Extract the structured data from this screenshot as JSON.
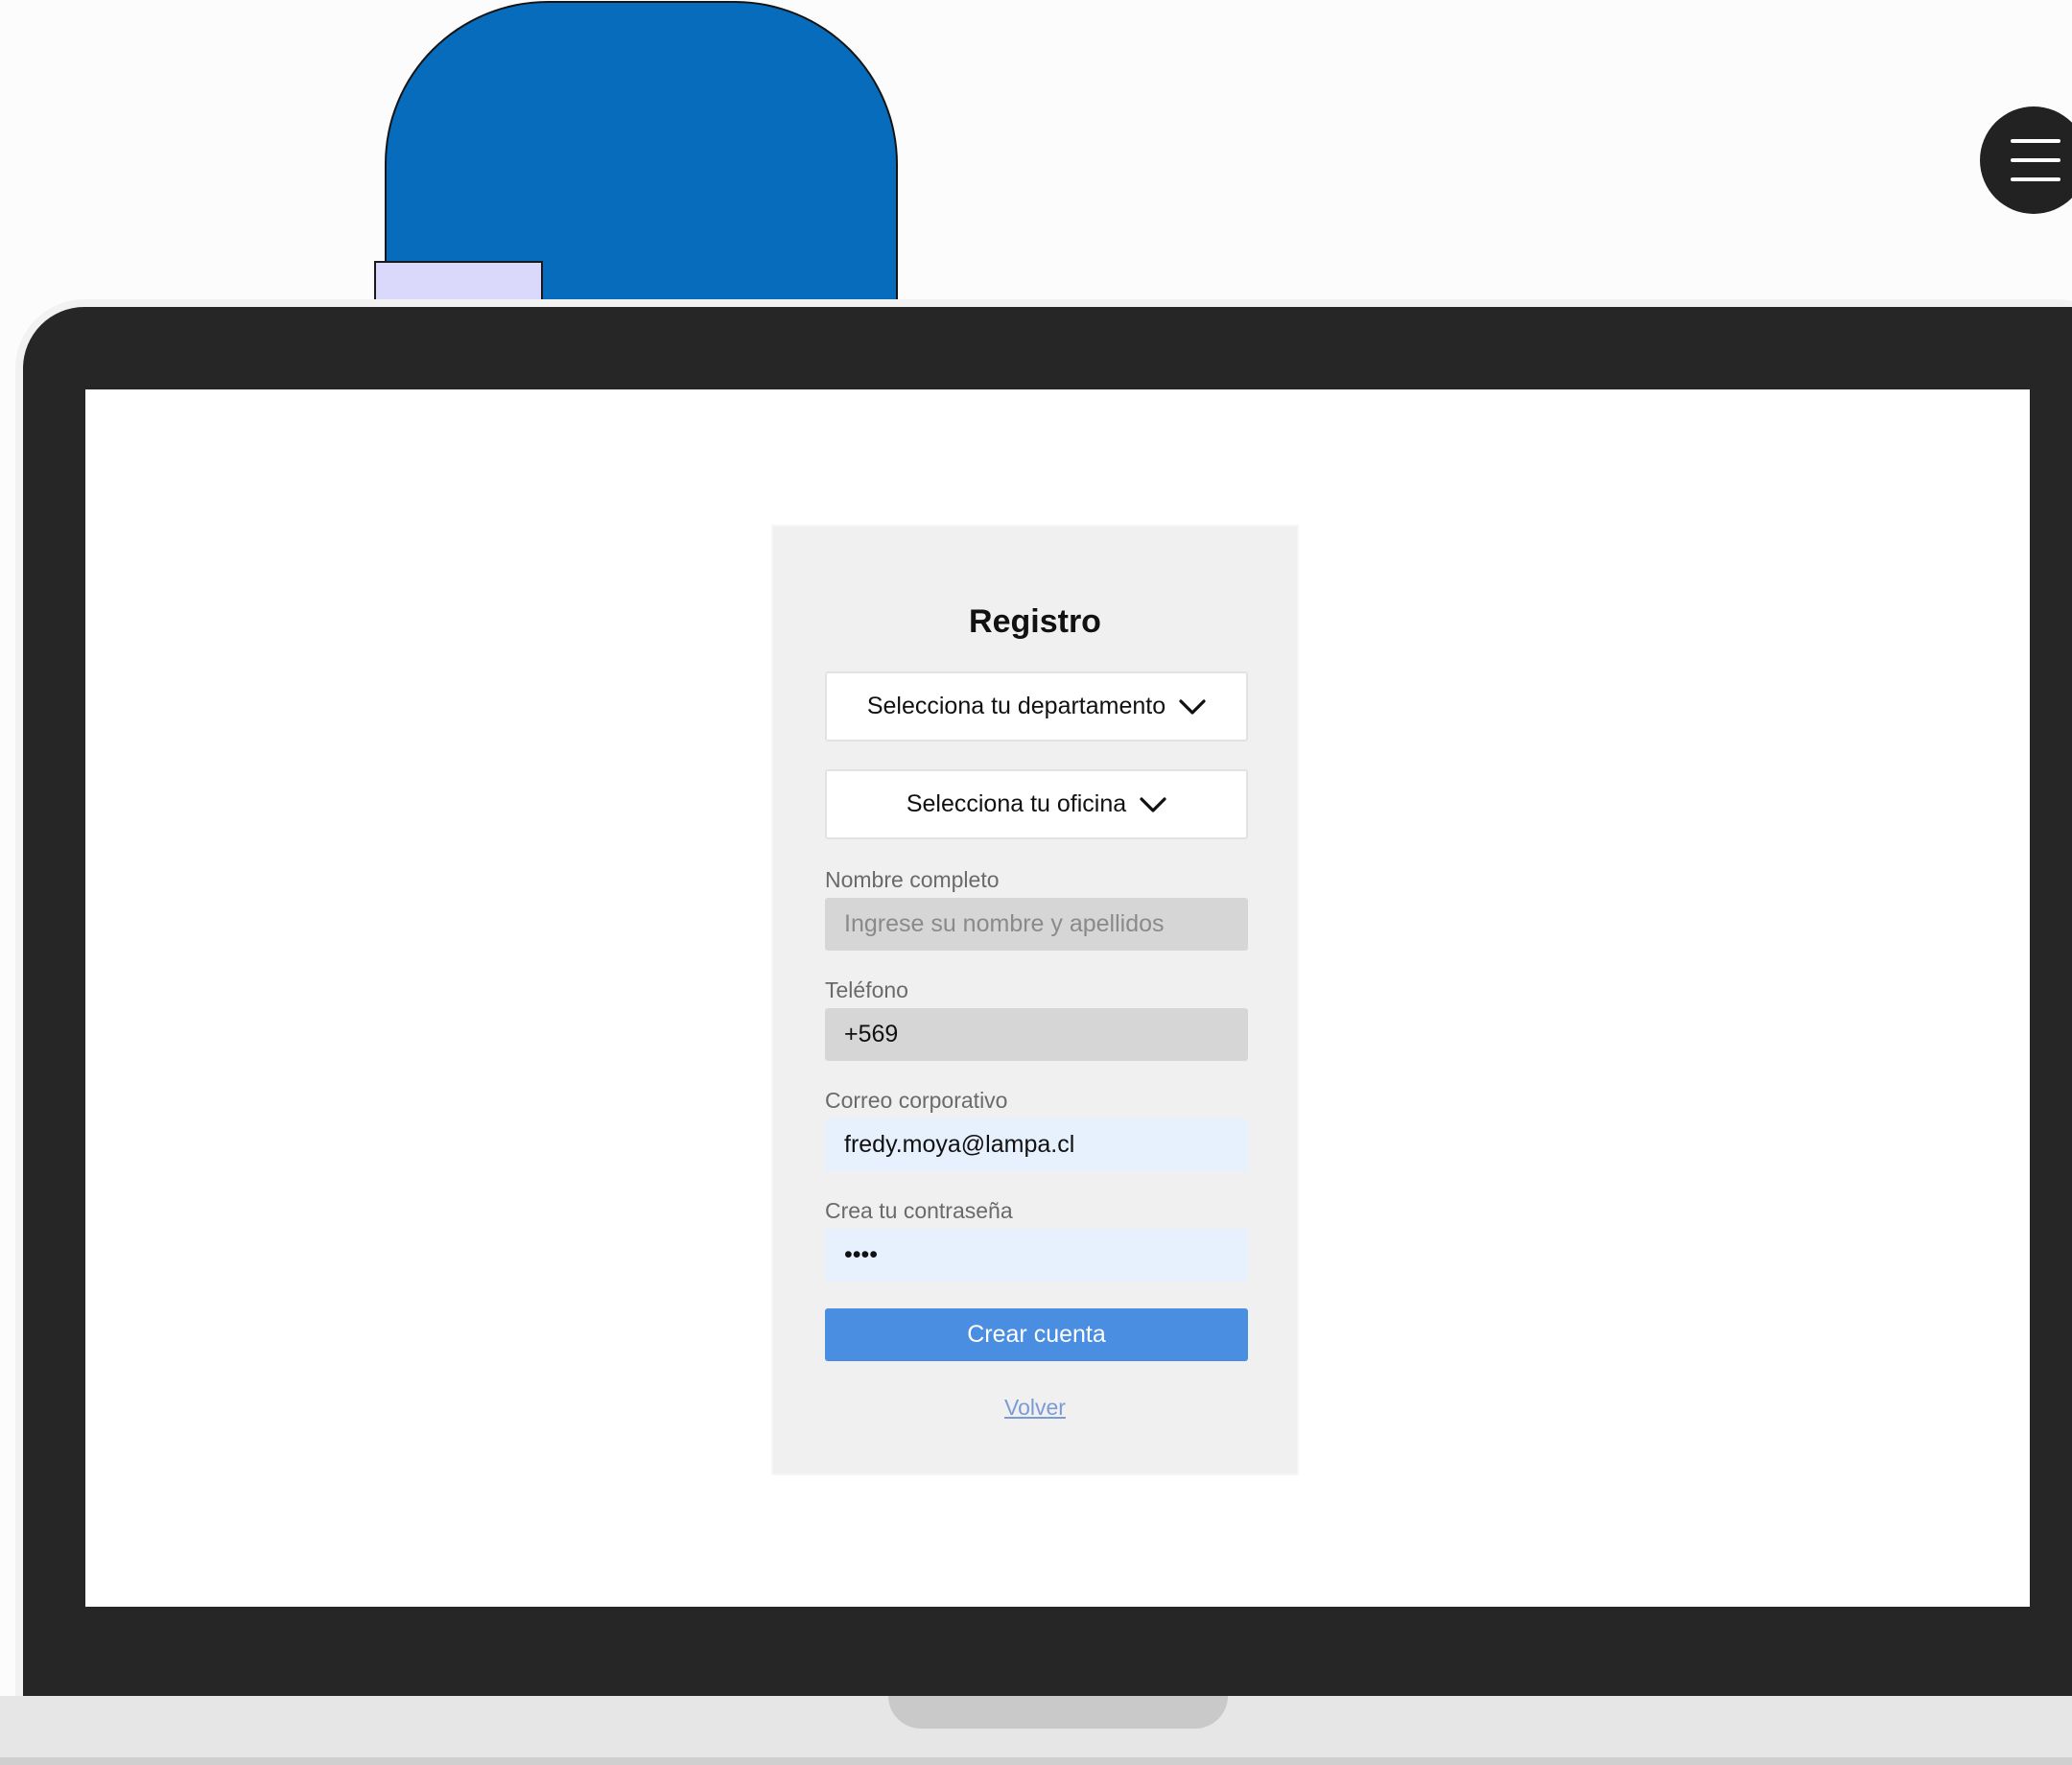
{
  "menu": {
    "icon": "hamburger-menu-icon"
  },
  "form": {
    "title": "Registro",
    "department_select": {
      "label": "Selecciona tu departamento",
      "icon": "chevron-down-icon"
    },
    "office_select": {
      "label": "Selecciona tu oficina",
      "icon": "chevron-down-icon"
    },
    "full_name": {
      "label": "Nombre completo",
      "value": "",
      "placeholder": "Ingrese su nombre y apellidos"
    },
    "phone": {
      "label": "Teléfono",
      "value": "+569",
      "placeholder": ""
    },
    "email": {
      "label": "Correo corporativo",
      "value": "fredy.moya@lampa.cl",
      "placeholder": ""
    },
    "password": {
      "label": "Crea tu contraseña",
      "value": "abcd"
    },
    "submit_label": "Crear cuenta",
    "back_label": "Volver"
  },
  "colors": {
    "accent": "#4a8ee2",
    "decor_blue": "#076cbc",
    "decor_lavender": "#dad9fc",
    "bezel": "#262626"
  }
}
